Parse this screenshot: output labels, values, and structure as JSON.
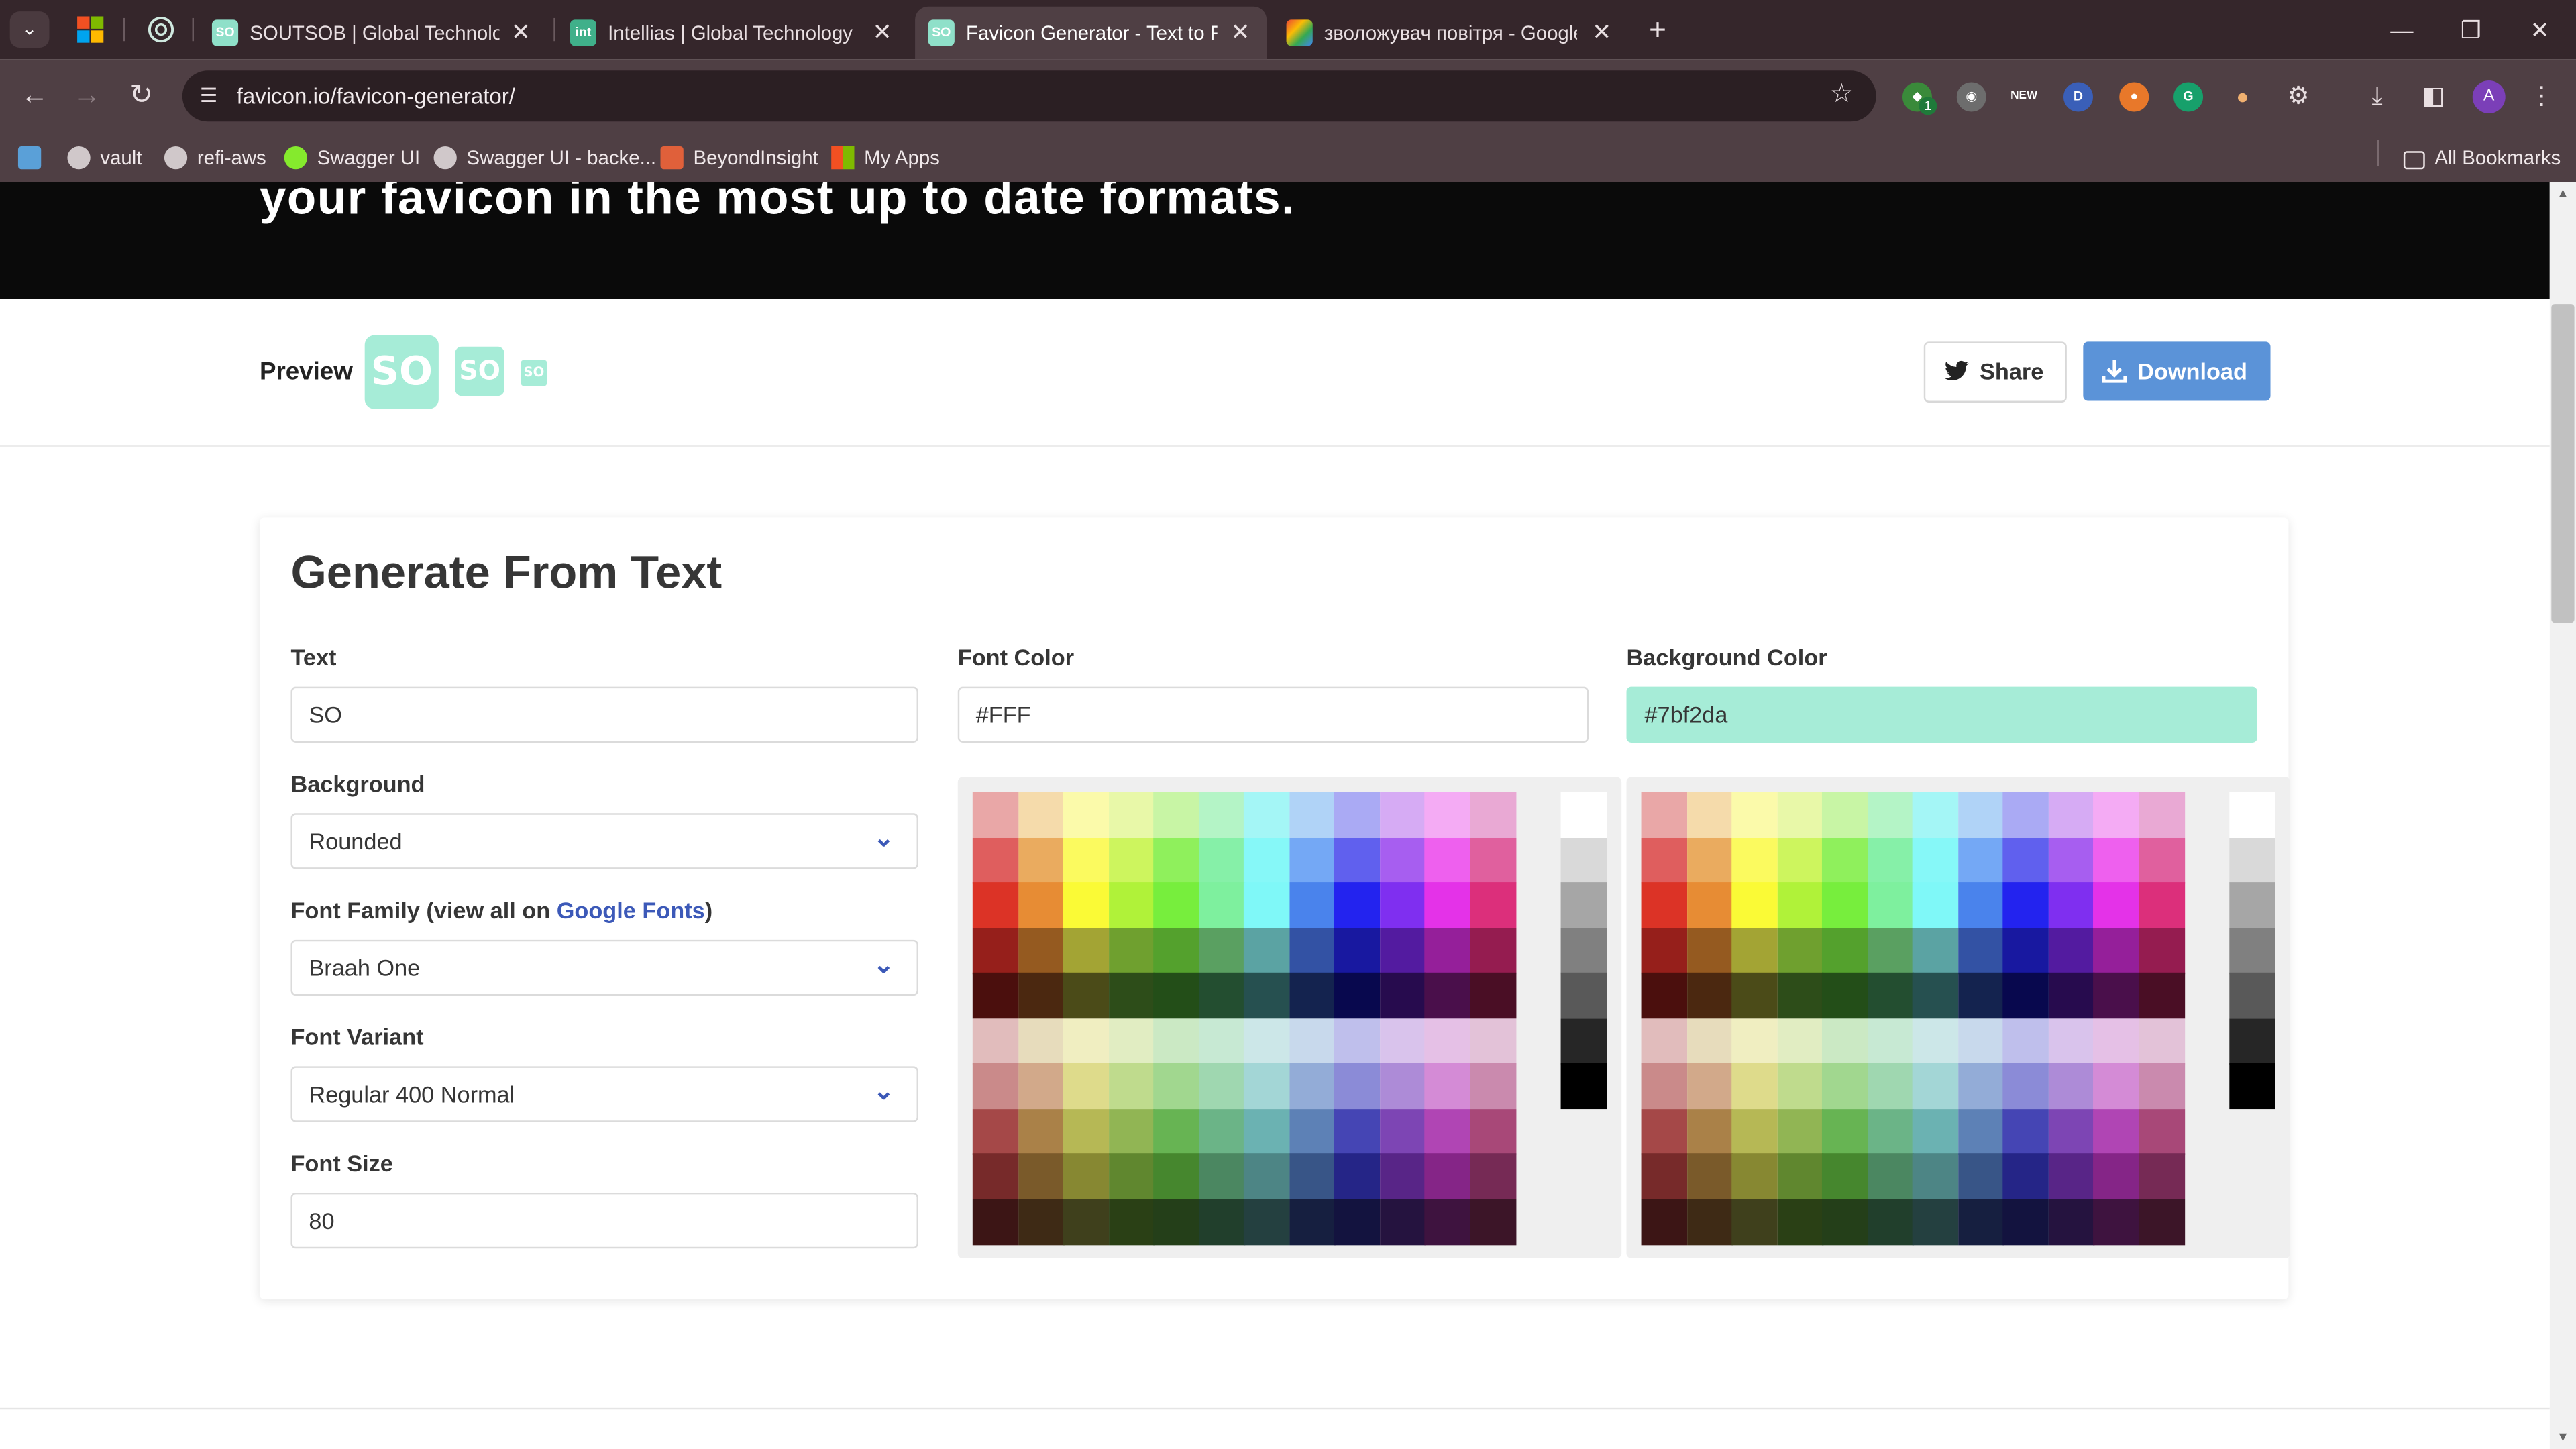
{
  "browser": {
    "tabs": [
      {
        "title": "SOUTSOB | Global Technology P",
        "favicon": "so-favicon",
        "active": false
      },
      {
        "title": "Intellias | Global Technology Pa",
        "favicon": "intellias-favicon",
        "active": false
      },
      {
        "title": "Favicon Generator - Text to Favi",
        "favicon": "so-favicon",
        "active": true
      },
      {
        "title": "зволожувач повітря - Google S",
        "favicon": "google-shopping-favicon",
        "active": false
      }
    ],
    "url": "favicon.io/favicon-generator/",
    "bookmarks": [
      "vault",
      "refi-aws",
      "Swagger UI",
      "Swagger UI - backe...",
      "BeyondInsight",
      "My Apps"
    ],
    "all_bookmarks": "All Bookmarks",
    "avatar_letter": "A",
    "extension_badge": "1",
    "ext_new_label": "NEW"
  },
  "page": {
    "hero_text": "your favicon in the most up to date formats.",
    "preview_label": "Preview",
    "preview_glyph": "SO",
    "share_label": "Share",
    "download_label": "Download",
    "card_title": "Generate From Text",
    "form": {
      "text_label": "Text",
      "text_value": "SO",
      "background_label": "Background",
      "background_value": "Rounded",
      "font_family_label": "Font Family (view all on ",
      "font_family_link": "Google Fonts",
      "font_family_close": ")",
      "font_family_value": "Braah One",
      "font_variant_label": "Font Variant",
      "font_variant_value": "Regular 400 Normal",
      "font_size_label": "Font Size",
      "font_size_value": "80",
      "font_color_label": "Font Color",
      "font_color_value": "#FFF",
      "bg_color_label": "Background Color",
      "bg_color_value": "#7bf2da"
    }
  },
  "colors": {
    "preview_bg": "#a6ecd7",
    "accent_blue": "#5b93d8",
    "link": "#3c59b8",
    "palette_rows": [
      [
        "#e9a7a7",
        "#f5dbab",
        "#fbfaaa",
        "#e8f8a8",
        "#c8f5a5",
        "#b4f4c6",
        "#a4f6f6",
        "#b0d3f7",
        "#aaaaf4",
        "#d6abf4",
        "#f4abf4",
        "#e9a9d4"
      ],
      [
        "#df5e5e",
        "#eaab5f",
        "#fbfa5f",
        "#cdf55e",
        "#8ff05c",
        "#86f0a8",
        "#86f8f8",
        "#74a8f5",
        "#6060ee",
        "#a75ef0",
        "#ee60ee",
        "#e0609e"
      ],
      [
        "#dc3326",
        "#e78c34",
        "#fafa36",
        "#b0f239",
        "#77ee3d",
        "#7ef09e",
        "#7ff8f8",
        "#4a83ec",
        "#2323ef",
        "#7f2ff0",
        "#e432e8",
        "#dc2f7b"
      ],
      [
        "#961f1b",
        "#955a20",
        "#a3a434",
        "#6fa02f",
        "#54a12d",
        "#5aa061",
        "#5ba3a3",
        "#3352a4",
        "#1818a0",
        "#531ba0",
        "#951f9a",
        "#951c50"
      ],
      [
        "#4b0f0d",
        "#4b2810",
        "#4b4b18",
        "#2d4d19",
        "#234e18",
        "#234e30",
        "#265050",
        "#14234f",
        "#08084e",
        "#270b4e",
        "#4a0f4b",
        "#4a0e25"
      ],
      [
        "#e1bcbc",
        "#e7dcbc",
        "#f0eec1",
        "#e1edc2",
        "#cbe9c4",
        "#c7e9d3",
        "#cce7e8",
        "#c8d9ec",
        "#bfbfec",
        "#d9c3ec",
        "#e5c0e6",
        "#e3c2d8"
      ],
      [
        "#ca8a8a",
        "#d2a98a",
        "#dedb8b",
        "#bfdb8d",
        "#a1d78f",
        "#9fd7b0",
        "#a3d6d6",
        "#93acd7",
        "#8b8bd7",
        "#ad8bd7",
        "#d48bd6",
        "#ca8aae"
      ],
      [
        "#a54848",
        "#aa8148",
        "#b6b855",
        "#91b554",
        "#67b453",
        "#6bb487",
        "#6bb2b2",
        "#5d81b6",
        "#4545b4",
        "#7d45b4",
        "#b045b4",
        "#a84878"
      ],
      [
        "#772a2a",
        "#7a5a2a",
        "#878832",
        "#60872f",
        "#46872e",
        "#4b8761",
        "#4d8585",
        "#385587",
        "#252587",
        "#582587",
        "#852587",
        "#762a55"
      ],
      [
        "#3c1515",
        "#3e2a15",
        "#3f401c",
        "#2a4015",
        "#243f19",
        "#213f2c",
        "#244040",
        "#161f40",
        "#13133f",
        "#25133f",
        "#3e133f",
        "#3c1528"
      ]
    ],
    "grays": [
      "#ffffff",
      "#d9d9d9",
      "#a6a6a6",
      "#808080",
      "#595959",
      "#262626",
      "#000000"
    ]
  }
}
